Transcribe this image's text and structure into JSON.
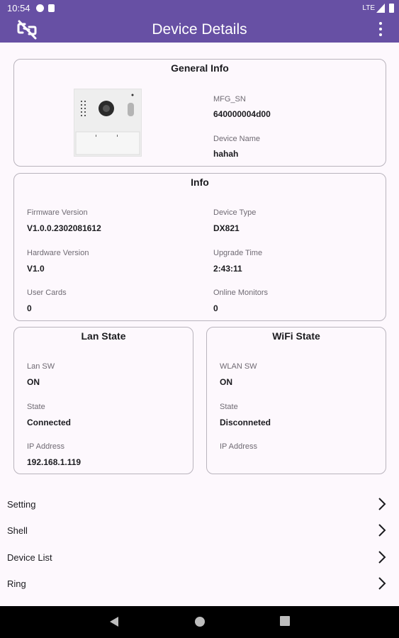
{
  "status_bar": {
    "time": "10:54",
    "network": "LTE"
  },
  "app_bar": {
    "title": "Device Details",
    "left_icon": "link-off-icon",
    "right_icon": "more-vert-icon"
  },
  "general_info": {
    "title": "General Info",
    "device_image": "door-station-panel-image",
    "mfg_sn_label": "MFG_SN",
    "mfg_sn_value": "640000004d00",
    "device_name_label": "Device Name",
    "device_name_value": "hahah"
  },
  "info": {
    "title": "Info",
    "firmware_label": "Firmware Version",
    "firmware_value": "V1.0.0.2302081612",
    "device_type_label": "Device Type",
    "device_type_value": "DX821",
    "hardware_label": "Hardware Version",
    "hardware_value": "V1.0",
    "upgrade_time_label": "Upgrade Time",
    "upgrade_time_value": "2:43:11",
    "user_cards_label": "User Cards",
    "user_cards_value": "0",
    "online_monitors_label": "Online Monitors",
    "online_monitors_value": "0"
  },
  "lan_state": {
    "title": "Lan State",
    "sw_label": "Lan SW",
    "sw_value": "ON",
    "state_label": "State",
    "state_value": "Connected",
    "ip_label": "IP Address",
    "ip_value": "192.168.1.119"
  },
  "wifi_state": {
    "title": "WiFi State",
    "sw_label": "WLAN SW",
    "sw_value": "ON",
    "state_label": "State",
    "state_value": "Disconneted",
    "ip_label": "IP Address",
    "ip_value": ""
  },
  "menu": [
    {
      "label": "Setting",
      "icon": "chevron-right-icon"
    },
    {
      "label": "Shell",
      "icon": "chevron-right-icon"
    },
    {
      "label": "Device List",
      "icon": "chevron-right-icon"
    },
    {
      "label": "Ring",
      "icon": "chevron-right-icon"
    }
  ],
  "colors": {
    "primary": "#6750a4",
    "background": "#fdf8fd",
    "card_border": "#b9b4bd",
    "navbar": "#000000"
  }
}
